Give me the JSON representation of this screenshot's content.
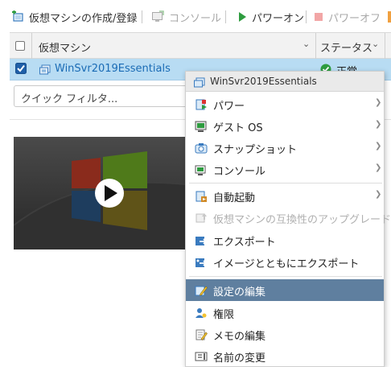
{
  "toolbar": {
    "create_vm": "仮想マシンの作成/登録",
    "console": "コンソール",
    "power_on": "パワーオン",
    "power_off": "パワーオフ"
  },
  "grid": {
    "col_name": "仮想マシン",
    "col_status": "ステータス",
    "row": {
      "name": "WinSvr2019Essentials",
      "status": "正常",
      "checked": true
    }
  },
  "filter": {
    "placeholder": "クイック フィルタ..."
  },
  "context_menu": {
    "title": "WinSvr2019Essentials",
    "items": [
      {
        "label": "パワー",
        "icon": "power-icon",
        "submenu": true
      },
      {
        "label": "ゲスト OS",
        "icon": "guest-os-icon",
        "submenu": true
      },
      {
        "label": "スナップショット",
        "icon": "snapshot-icon",
        "submenu": true
      },
      {
        "label": "コンソール",
        "icon": "console-icon",
        "submenu": true
      },
      {
        "label": "自動起動",
        "icon": "autostart-icon",
        "submenu": true
      },
      {
        "label": "仮想マシンの互換性のアップグレード",
        "icon": "upgrade-compat-icon",
        "disabled": true
      },
      {
        "label": "エクスポート",
        "icon": "export-icon"
      },
      {
        "label": "イメージとともにエクスポート",
        "icon": "export-with-images-icon"
      },
      {
        "label": "設定の編集",
        "icon": "edit-settings-icon",
        "highlighted": true
      },
      {
        "label": "権限",
        "icon": "permissions-icon"
      },
      {
        "label": "メモの編集",
        "icon": "edit-notes-icon"
      },
      {
        "label": "名前の変更",
        "icon": "rename-icon"
      }
    ]
  },
  "colors": {
    "selected_row": "#b8dcf3",
    "menu_highlight": "#5f7f9f",
    "status_ok": "#2e9c3f",
    "link_blue": "#1a6bb5"
  }
}
